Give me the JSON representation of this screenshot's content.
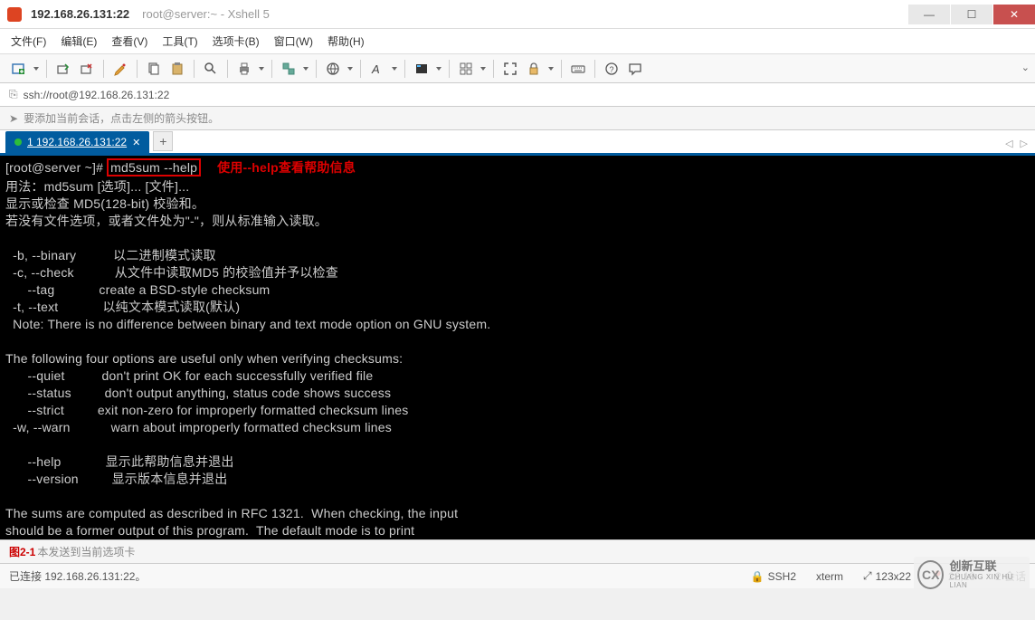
{
  "window": {
    "host": "192.168.26.131:22",
    "subtitle": "root@server:~ - Xshell 5"
  },
  "menu": {
    "file": "文件(F)",
    "edit": "编辑(E)",
    "view": "查看(V)",
    "tools": "工具(T)",
    "tabs": "选项卡(B)",
    "window": "窗口(W)",
    "help": "帮助(H)"
  },
  "address": {
    "url": "ssh://root@192.168.26.131:22"
  },
  "hint": {
    "text": "要添加当前会话，点击左侧的箭头按钮。"
  },
  "tab": {
    "label": "1 192.168.26.131:22"
  },
  "terminal": {
    "prompt": "[root@server ~]# ",
    "command": "md5sum --help",
    "annotation": "使用--help查看帮助信息",
    "lines": [
      "用法：md5sum [选项]... [文件]...",
      "显示或检查 MD5(128-bit) 校验和。",
      "若没有文件选项，或者文件处为\"-\"，则从标准输入读取。",
      "",
      "  -b, --binary          以二进制模式读取",
      "  -c, --check           从文件中读取MD5 的校验值并予以检查",
      "      --tag            create a BSD-style checksum",
      "  -t, --text            以纯文本模式读取(默认)",
      "  Note: There is no difference between binary and text mode option on GNU system.",
      "",
      "The following four options are useful only when verifying checksums:",
      "      --quiet          don't print OK for each successfully verified file",
      "      --status         don't output anything, status code shows success",
      "      --strict         exit non-zero for improperly formatted checksum lines",
      "  -w, --warn           warn about improperly formatted checksum lines",
      "",
      "      --help            显示此帮助信息并退出",
      "      --version         显示版本信息并退出",
      "",
      "The sums are computed as described in RFC 1321.  When checking, the input",
      "should be a former output of this program.  The default mode is to print"
    ]
  },
  "footer": {
    "fig_label": "图2-1",
    "send_hint": "本发送到当前选项卡",
    "status": "已连接 192.168.26.131:22。",
    "ssh": "SSH2",
    "term": "xterm",
    "size": "123x22",
    "pos": "22,18",
    "sessions": "2 会话"
  },
  "watermark": {
    "brand": "创新互联",
    "sub": "CHUANG XIN HU LIAN"
  }
}
